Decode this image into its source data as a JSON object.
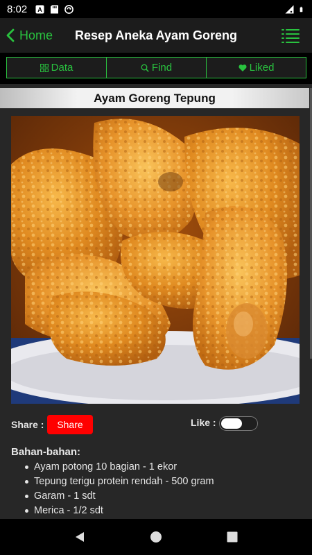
{
  "status_bar": {
    "time": "8:02",
    "left_icons": [
      "a-icon",
      "sd-card-icon",
      "sync-icon"
    ],
    "right_icons": [
      "signal-icon",
      "battery-icon"
    ]
  },
  "header": {
    "back_label": "Home",
    "title": "Resep Aneka Ayam Goreng"
  },
  "tabs": [
    {
      "label": "Data",
      "icon": "grid-icon"
    },
    {
      "label": "Find",
      "icon": "search-icon"
    },
    {
      "label": "Liked",
      "icon": "heart-icon"
    }
  ],
  "recipe": {
    "title": "Ayam Goreng Tepung",
    "share_label": "Share :",
    "share_button": "Share",
    "like_label": "Like :",
    "like_on": false,
    "ingredients_title": "Bahan-bahan:",
    "ingredients": [
      "Ayam potong 10 bagian - 1 ekor",
      "Tepung terigu protein rendah - 500 gram",
      "Garam - 1 sdt",
      "Merica - 1/2 sdt"
    ]
  },
  "colors": {
    "accent": "#29c23f",
    "share": "#ff0000"
  }
}
